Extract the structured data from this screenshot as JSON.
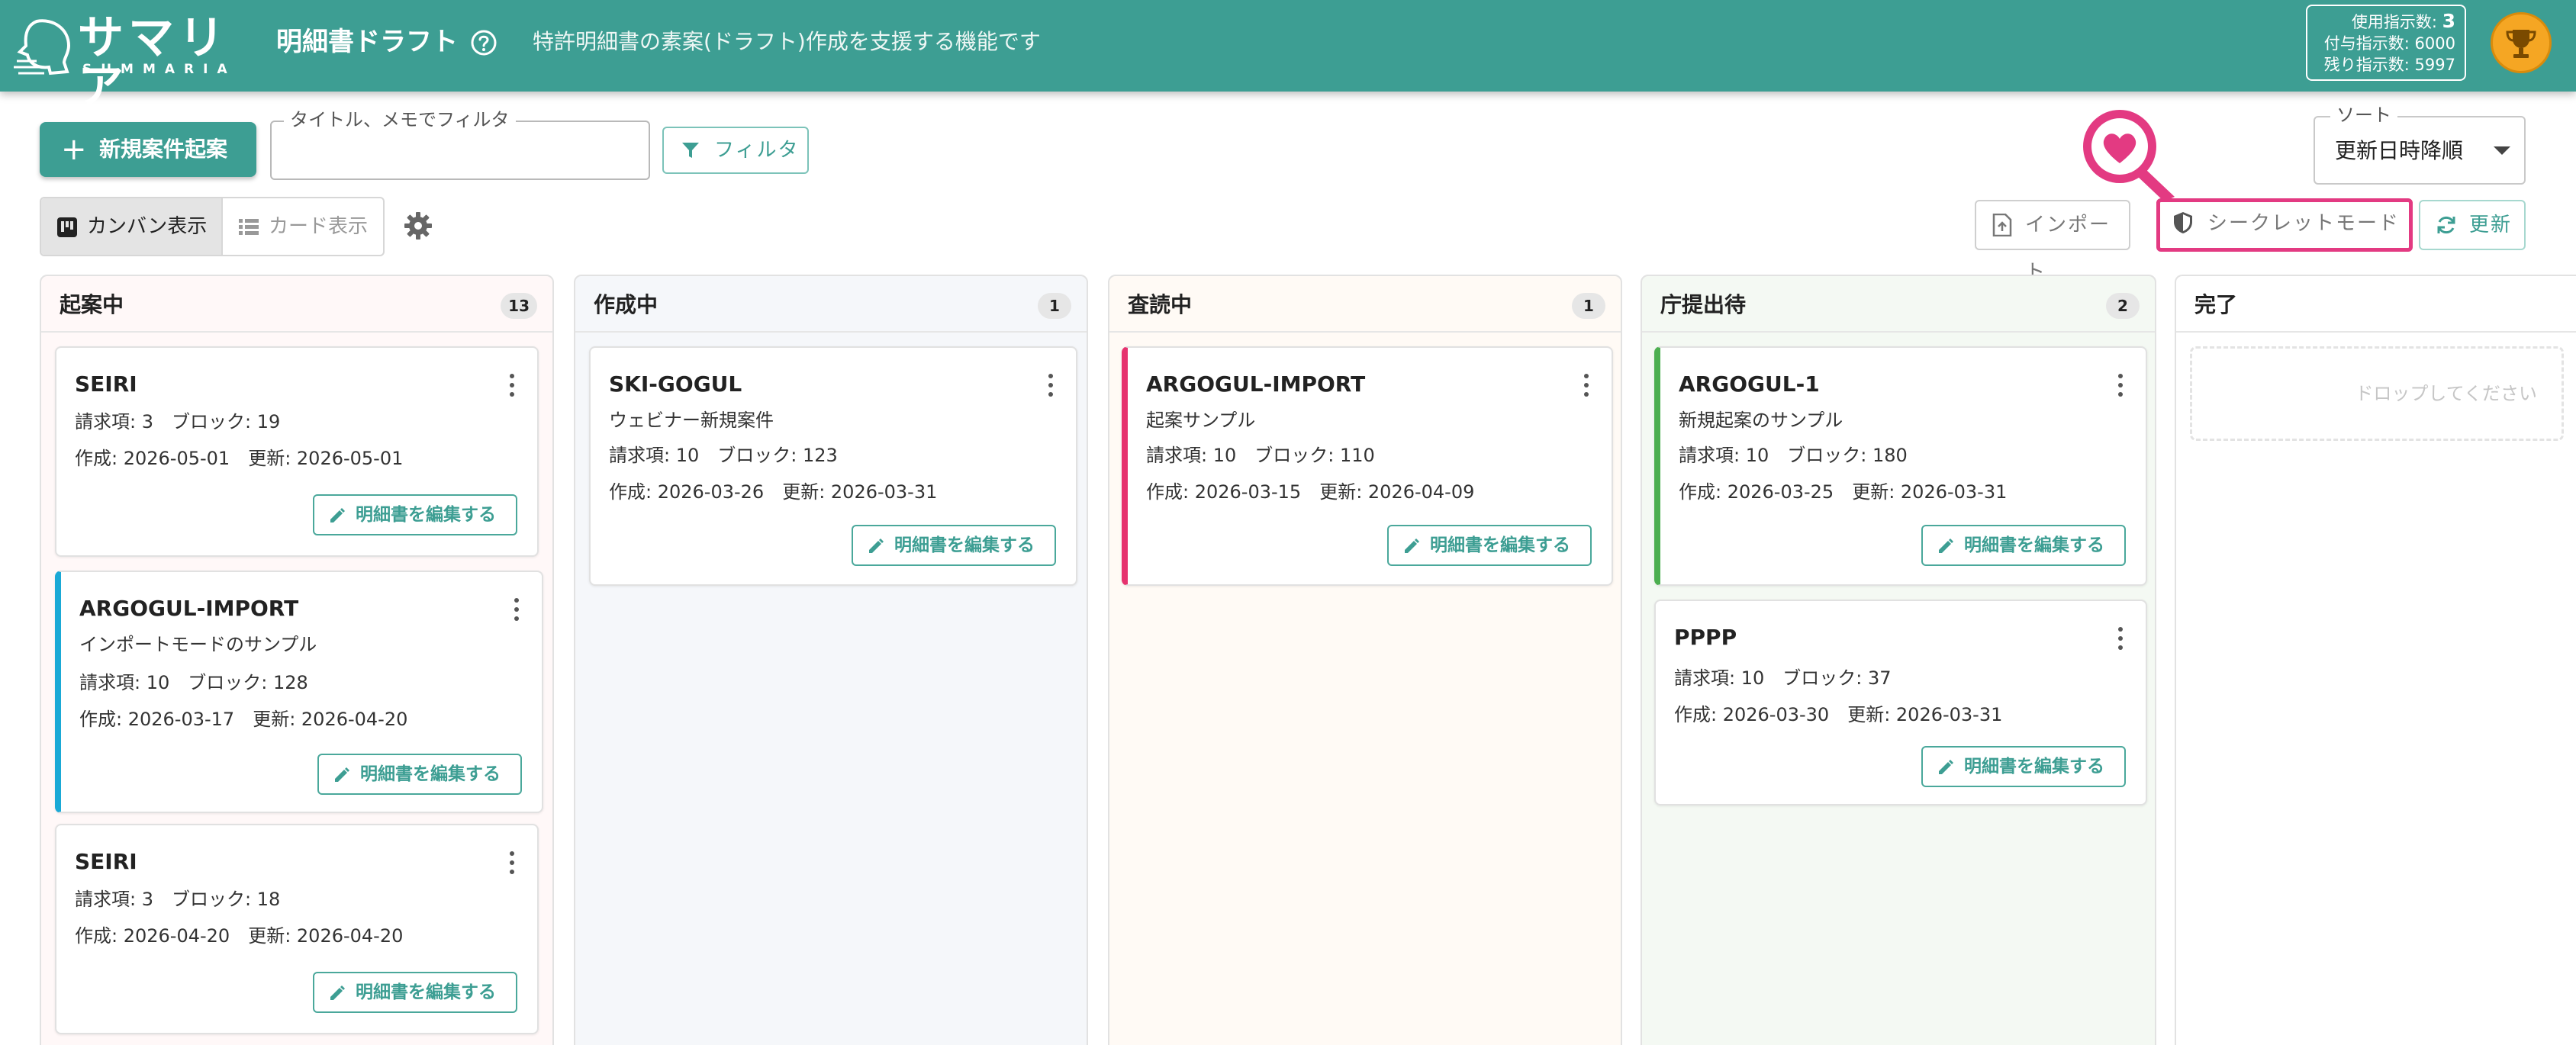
{
  "header": {
    "logo_jp": "サマリア",
    "logo_en": "SUMMARIA",
    "title": "明細書ドラフト",
    "description": "特許明細書の素案(ドラフト)作成を支援する機能です",
    "usage": {
      "used_label": "使用指示数:",
      "used_value": "3",
      "granted_line": "付与指示数: 6000",
      "remaining_line": "残り指示数: 5997"
    }
  },
  "toolbar": {
    "new_button": "新規案件起案",
    "filter_legend": "タイトル、メモでフィルタ",
    "filter_value": "",
    "filter_button": "フィルタ",
    "sort_legend": "ソート",
    "sort_value": "更新日時降順",
    "view_kanban": "カンバン表示",
    "view_card": "カード表示",
    "import_button": "インポート",
    "secret_button": "シークレットモード",
    "refresh_button": "更新"
  },
  "columns": [
    {
      "title": "起案中",
      "count": "13",
      "cards": [
        {
          "title": "SEIRI",
          "counts": "請求項: 3　ブロック: 19",
          "dates": "作成: 2026-05-01　更新: 2026-05-01",
          "edit": "明細書を編集する"
        },
        {
          "title": "ARGOGUL-IMPORT",
          "subtitle": "インポートモードのサンプル",
          "counts": "請求項: 10　ブロック: 128",
          "dates": "作成: 2026-03-17　更新: 2026-04-20",
          "edit": "明細書を編集する"
        },
        {
          "title": "SEIRI",
          "counts": "請求項: 3　ブロック: 18",
          "dates": "作成: 2026-04-20　更新: 2026-04-20",
          "edit": "明細書を編集する"
        }
      ]
    },
    {
      "title": "作成中",
      "count": "1",
      "cards": [
        {
          "title": "SKI-GOGUL",
          "subtitle": "ウェビナー新規案件",
          "counts": "請求項: 10　ブロック: 123",
          "dates": "作成: 2026-03-26　更新: 2026-03-31",
          "edit": "明細書を編集する"
        }
      ]
    },
    {
      "title": "査読中",
      "count": "1",
      "cards": [
        {
          "title": "ARGOGUL-IMPORT",
          "subtitle": "起案サンプル",
          "counts": "請求項: 10　ブロック: 110",
          "dates": "作成: 2026-03-15　更新: 2026-04-09",
          "edit": "明細書を編集する"
        }
      ]
    },
    {
      "title": "庁提出待",
      "count": "2",
      "cards": [
        {
          "title": "ARGOGUL-1",
          "subtitle": "新規起案のサンプル",
          "counts": "請求項: 10　ブロック: 180",
          "dates": "作成: 2026-03-25　更新: 2026-03-31",
          "edit": "明細書を編集する"
        },
        {
          "title": "PPPP",
          "counts": "請求項: 10　ブロック: 37",
          "dates": "作成: 2026-03-30　更新: 2026-03-31",
          "edit": "明細書を編集する"
        }
      ]
    },
    {
      "title": "完了",
      "drop_hint": "ドロップしてください"
    }
  ],
  "colors": {
    "brand": "#3d9e93",
    "highlight": "#e33a82",
    "accent_blue": "#1aa9d6",
    "accent_pink": "#e6326e",
    "accent_green": "#4caf50"
  }
}
